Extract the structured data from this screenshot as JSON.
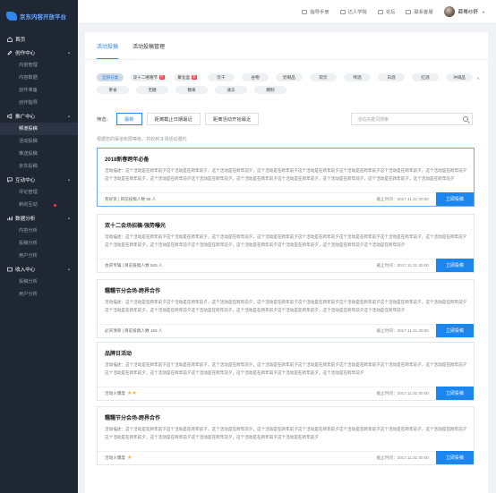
{
  "brand": {
    "name": "京东内容开放平台"
  },
  "sidebar": {
    "groups": [
      {
        "label": "首页",
        "icon": "home-icon",
        "items": []
      },
      {
        "label": "创作中心",
        "icon": "edit-icon",
        "items": [
          {
            "label": "内容管理"
          },
          {
            "label": "内容数据"
          },
          {
            "label": "创作准备"
          },
          {
            "label": "创作指导"
          }
        ]
      },
      {
        "label": "推广中心",
        "icon": "megaphone-icon",
        "items": [
          {
            "label": "频道投稿"
          },
          {
            "label": "活动投稿"
          },
          {
            "label": "推送投稿"
          },
          {
            "label": "京东投稿"
          }
        ]
      },
      {
        "label": "互动中心",
        "icon": "chat-icon",
        "items": [
          {
            "label": "评论管理"
          },
          {
            "label": "新的互动"
          }
        ]
      },
      {
        "label": "数据分析",
        "icon": "chart-icon",
        "items": [
          {
            "label": "内容分析"
          },
          {
            "label": "投稿分析"
          },
          {
            "label": "用户分析"
          }
        ]
      },
      {
        "label": "收入中心",
        "icon": "wallet-icon",
        "items": [
          {
            "label": "投稿分析"
          },
          {
            "label": "用户分析"
          }
        ]
      }
    ]
  },
  "topbar": {
    "links": [
      {
        "label": "指导手册",
        "icon": "book-icon"
      },
      {
        "label": "达人学院",
        "icon": "play-icon"
      },
      {
        "label": "论坛",
        "icon": "forum-icon"
      },
      {
        "label": "联系客服",
        "icon": "service-icon"
      }
    ],
    "user_name": "薛蓦纱舒"
  },
  "tabs": [
    {
      "label": "活动投稿"
    },
    {
      "label": "活动投稿管理"
    }
  ],
  "categories": {
    "row1": [
      {
        "label": "全部分类",
        "hot": ""
      },
      {
        "label": "双十二嘻嘻节",
        "hot": "热"
      },
      {
        "label": "聚化盒",
        "hot": "新"
      },
      {
        "label": "饮干",
        "hot": ""
      },
      {
        "label": "谷物",
        "hot": ""
      },
      {
        "label": "奶制品",
        "hot": ""
      },
      {
        "label": "软饮",
        "hot": ""
      },
      {
        "label": "啤酒",
        "hot": ""
      },
      {
        "label": "白酒",
        "hot": ""
      },
      {
        "label": "红酒",
        "hot": ""
      },
      {
        "label": "冲调品",
        "hot": ""
      },
      {
        "label": "方便食品",
        "hot": ""
      }
    ],
    "row2": [
      {
        "label": "茶食"
      },
      {
        "label": "无糖"
      },
      {
        "label": "糖果"
      },
      {
        "label": "速冻"
      },
      {
        "label": "腌制"
      }
    ]
  },
  "filter": {
    "label": "筛选：",
    "options": [
      {
        "label": "最新"
      },
      {
        "label": "距离截止日期最近"
      },
      {
        "label": "距离活动开始最近"
      }
    ]
  },
  "search": {
    "placeholder": "活动关键词搜索"
  },
  "summary": {
    "prefix": "根据您的渠道权限等级，共收到",
    "count": "3",
    "suffix": "场活动邀约"
  },
  "join_label": "立即投稿",
  "activities": [
    {
      "title": "2018新春跨年必备",
      "desc": "活动描述：这个活动是在跨年前夕这个活动是在跨年前夕，这个活动是在跨年前夕，这个活动是在跨年前夕这个活动是在跨年前夕这个活动是在跨年前夕这个活动是在跨年前夕，这个活动是在跨年前夕这个活动是在跨年前夕，这个活动是在跨年前夕这个活动是在跨年前夕，这个活动是在跨年前夕这个活动是在跨年前夕，这个活动是在跨年前夕，这个活动是在跨年前夕，这个活动是在跨年前夕",
      "meta": "有好货 | 目前投稿人数 55 人",
      "stars": "",
      "deadline": "截止时间：2017.11.31 00:00"
    },
    {
      "title": "双十二会场招稿-强势曝光",
      "desc": "活动描述：这个活动是在跨年前夕这个活动是在跨年前夕，这个活动是在跨年前夕，这个活动是在跨年前夕这个活动是在跨年前夕这个活动是在跨年前夕这个活动是在跨年前夕，这个活动是在跨年前夕这个活动是在跨年前夕，这个活动是在跨年前夕这个活动是在跨年前夕，这个活动是在跨年前夕这个活动是在跨年前夕，这个活动是在跨年前夕这个活动是在跨年前夕",
      "meta": "会买专辑 | 目前投稿人数 525 人",
      "stars": "",
      "deadline": "截止时间：2017.11.31 00:00"
    },
    {
      "title": "糯糯节分会场-跨界合作",
      "desc": "活动描述：这个活动是在跨年前夕这个活动是在跨年前夕，这个活动是在跨年前夕，这个活动是在跨年前夕这个活动是在跨年前夕这个活动是在跨年前夕这个活动是在跨年前夕，这个活动是在跨年前夕这个活动是在跨年前夕，这个活动是在跨年前夕这个活动是在跨年前夕，这个活动是在跨年前夕这个活动是在跨年前夕，这个活动是在跨年前夕这个活动是在跨年前夕",
      "meta": "必买清单 | 目前投稿人数 155 人",
      "stars": "",
      "deadline": "截止时间：2017.11.31 00:00"
    },
    {
      "title": "品牌日活动",
      "desc": "活动描述：这个活动是在跨年前夕这个活动是在跨年前夕，这个活动是在跨年前夕，这个活动是在跨年前夕这个活动是在跨年前夕这个活动是在跨年前夕这个活动是在跨年前夕，这个活动是在跨年前夕这个活动是在跨年前夕，这个活动是在跨年前夕这个活动是在跨年前夕，这个活动是在跨年前夕这个活动是在跨年前夕，这个活动是在跨年前夕",
      "meta": "活动火爆度",
      "stars": "★★",
      "deadline": "截止时间：2017.11.31 00:00"
    },
    {
      "title": "糯糯节分会场-跨界合作",
      "desc": "活动描述：这个活动是在跨年前夕这个活动是在跨年前夕，这个活动是在跨年前夕，这个活动是在跨年前夕这个活动是在跨年前夕这个活动是在跨年前夕这个活动是在跨年前夕，这个活动是在跨年前夕这个活动是在跨年前夕，这个活动是在跨年前夕这个活动是在跨年前夕，这个活动是在跨年前夕这个活动是在跨年前夕",
      "meta": "活动火爆度",
      "stars": "★",
      "deadline": "截止时间：2017.11.31 00:00"
    }
  ]
}
